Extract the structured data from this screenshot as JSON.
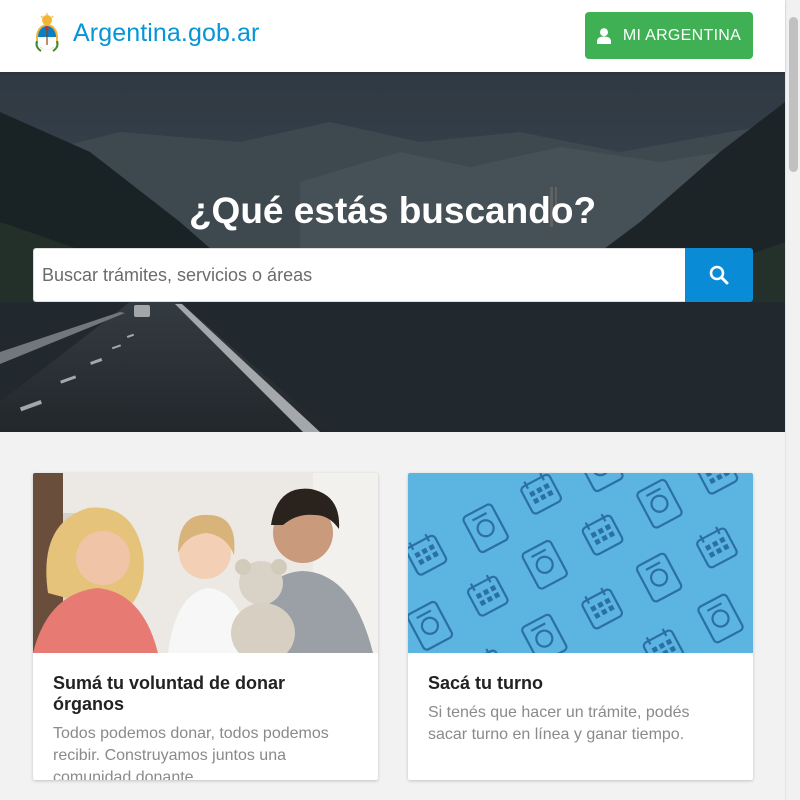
{
  "header": {
    "logo_text": "Argentina.gob.ar",
    "mi_argentina_label": "MI ARGENTINA"
  },
  "hero": {
    "title": "¿Qué estás buscando?",
    "search_placeholder": "Buscar trámites, servicios o áreas",
    "search_value": ""
  },
  "cards": [
    {
      "title": "Sumá tu voluntad de donar órganos",
      "text": "Todos podemos donar, todos podemos recibir. Construyamos juntos una comunidad donante."
    },
    {
      "title": "Sacá tu turno",
      "text": "Si tenés que hacer un trámite, podés sacar turno en línea y ganar tiempo."
    }
  ],
  "colors": {
    "brand_blue": "#0695d6",
    "green_button": "#3fb154",
    "search_button": "#0a8bd6",
    "pattern_blue": "#5cb4e0"
  },
  "icons": [
    "argentina-coat-of-arms-icon",
    "user-icon",
    "search-icon",
    "calendar-icon",
    "dni-card-icon",
    "wheelchair-card-icon",
    "clock-card-icon"
  ]
}
